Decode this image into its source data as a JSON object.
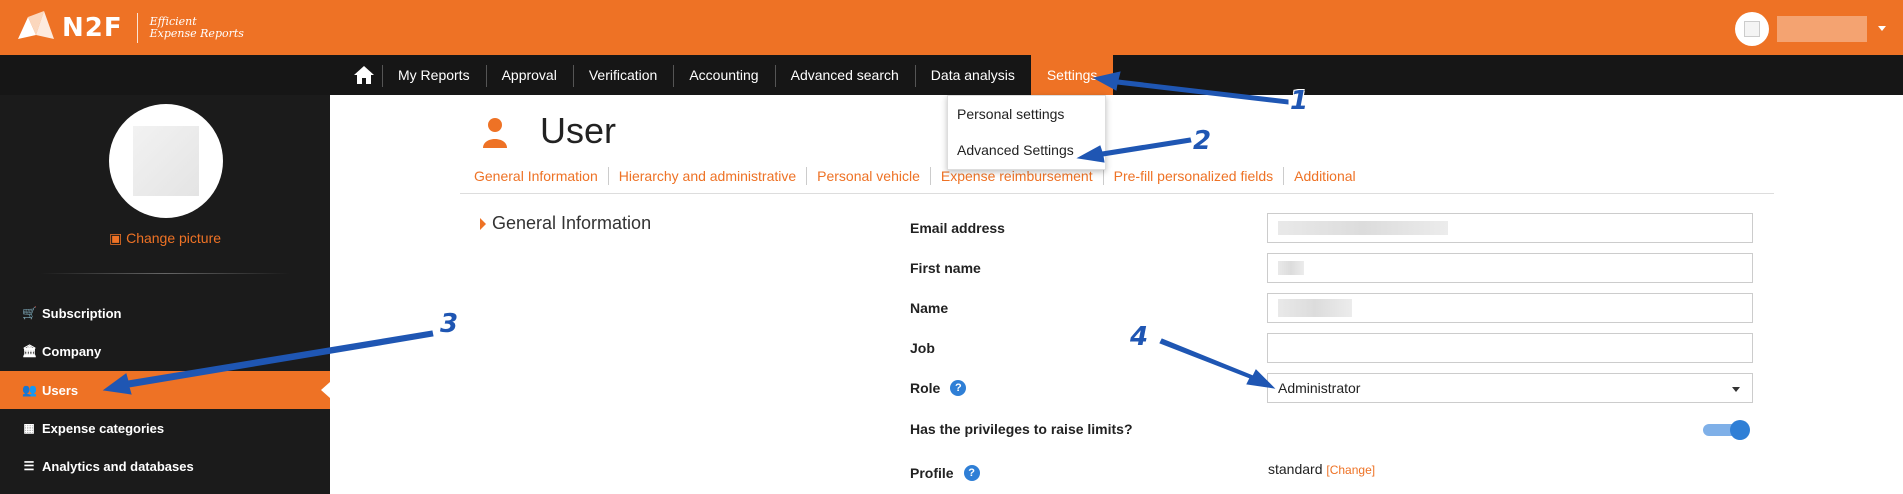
{
  "app": {
    "logo_text": "N2F",
    "tagline_line1": "Efficient",
    "tagline_line2": "Expense Reports"
  },
  "nav": {
    "items": [
      {
        "label": "My Reports"
      },
      {
        "label": "Approval"
      },
      {
        "label": "Verification"
      },
      {
        "label": "Accounting"
      },
      {
        "label": "Advanced search"
      },
      {
        "label": "Data analysis"
      },
      {
        "label": "Settings",
        "active": true
      }
    ]
  },
  "settings_dropdown": {
    "items": [
      {
        "label": "Personal settings"
      },
      {
        "label": "Advanced Settings"
      }
    ]
  },
  "sidebar": {
    "change_picture": "Change picture",
    "items": [
      {
        "label": "Subscription",
        "icon": "cart-icon"
      },
      {
        "label": "Company",
        "icon": "bank-icon"
      },
      {
        "label": "Users",
        "icon": "users-icon",
        "active": true
      },
      {
        "label": "Expense categories",
        "icon": "grid-icon"
      },
      {
        "label": "Analytics and databases",
        "icon": "list-icon"
      }
    ]
  },
  "page": {
    "title": "User",
    "subtabs": [
      {
        "label": "General Information"
      },
      {
        "label": "Hierarchy and administrative"
      },
      {
        "label": "Personal vehicle"
      },
      {
        "label": "Expense reimbursement"
      },
      {
        "label": "Pre-fill personalized fields"
      },
      {
        "label": "Additional"
      }
    ],
    "section_title": "General Information"
  },
  "form": {
    "email_label": "Email address",
    "first_name_label": "First name",
    "name_label": "Name",
    "job_label": "Job",
    "role_label": "Role",
    "role_value": "Administrator",
    "raise_limits_label": "Has the privileges to raise limits?",
    "raise_limits_on": true,
    "profile_label": "Profile",
    "profile_value": "standard",
    "profile_change": "Change",
    "profile_bracket_open": "[",
    "profile_bracket_close": "]"
  },
  "annotations": {
    "n1": "1",
    "n2": "2",
    "n3": "3",
    "n4": "4"
  },
  "colors": {
    "brand_orange": "#ee7225",
    "annotation_blue": "#1f56b3",
    "nav_dark": "#161616"
  }
}
